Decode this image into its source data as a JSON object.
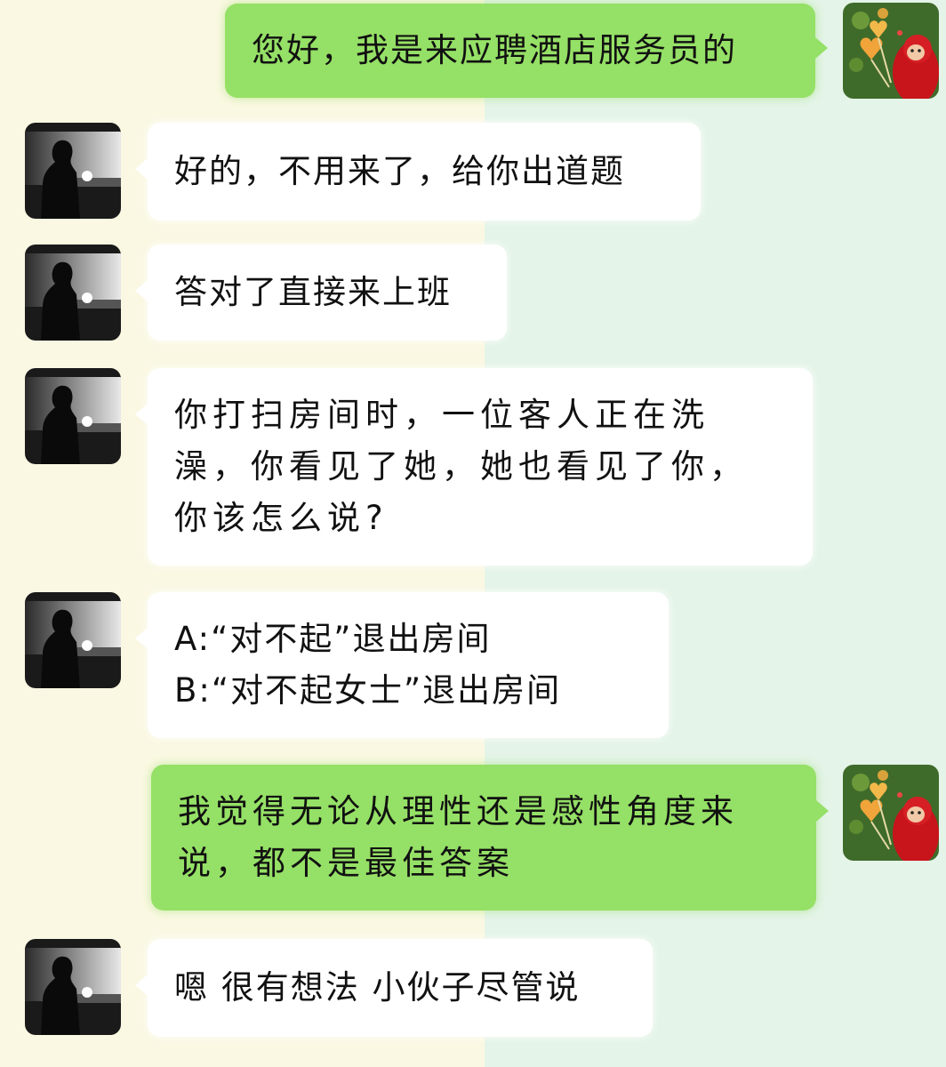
{
  "chat": {
    "messages": [
      {
        "sender": "me",
        "lines": [
          "您好，我是来应聘酒店服务员的"
        ]
      },
      {
        "sender": "other",
        "lines": [
          "好的，不用来了，给你出道题"
        ]
      },
      {
        "sender": "other",
        "lines": [
          "答对了直接来上班"
        ]
      },
      {
        "sender": "other",
        "lines": [
          "你打扫房间时，一位客人正在洗",
          "澡，你看见了她，她也看见了你，",
          "你该怎么说?"
        ]
      },
      {
        "sender": "other",
        "lines": [
          "A:“对不起”退出房间",
          "B:“对不起女士”退出房间"
        ]
      },
      {
        "sender": "me",
        "lines": [
          "我觉得无论从理性还是感性角度来",
          "说，都不是最佳答案"
        ]
      },
      {
        "sender": "other",
        "lines": [
          "嗯 很有想法 小伙子尽管说"
        ]
      }
    ]
  },
  "colors": {
    "outgoing_bubble": "#95e066",
    "incoming_bubble": "#ffffff",
    "background_left": "#faf8e2",
    "background_right": "#e4f4e8"
  },
  "icons": {
    "my_avatar": "red-character-with-orange-balloons-avatar",
    "other_avatar": "dark-silhouette-portrait-avatar"
  }
}
